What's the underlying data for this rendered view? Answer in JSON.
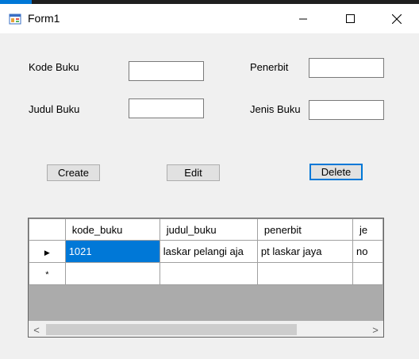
{
  "window": {
    "title": "Form1",
    "icon": "winforms-app-icon",
    "minimize_icon": "minimize-icon",
    "maximize_icon": "maximize-icon",
    "close_icon": "close-icon"
  },
  "form": {
    "kode_buku_label": "Kode Buku",
    "kode_buku_value": "",
    "judul_buku_label": "Judul Buku",
    "judul_buku_value": "",
    "penerbit_label": "Penerbit",
    "penerbit_value": "",
    "jenis_buku_label": "Jenis Buku",
    "jenis_buku_value": ""
  },
  "buttons": {
    "create": "Create",
    "edit": "Edit",
    "delete": "Delete"
  },
  "grid": {
    "columns": [
      "kode_buku",
      "judul_buku",
      "penerbit",
      "je"
    ],
    "rows": [
      {
        "indicator": "▶",
        "cells": [
          "1021",
          "laskar pelangi aja",
          "pt laskar jaya",
          "no"
        ]
      },
      {
        "indicator": "*",
        "cells": [
          "",
          "",
          "",
          ""
        ]
      }
    ],
    "scroll_left": "<",
    "scroll_right": ">"
  },
  "colors": {
    "selection": "#0078d7",
    "grid_background": "#ababab",
    "form_background": "#f0f0f0"
  }
}
